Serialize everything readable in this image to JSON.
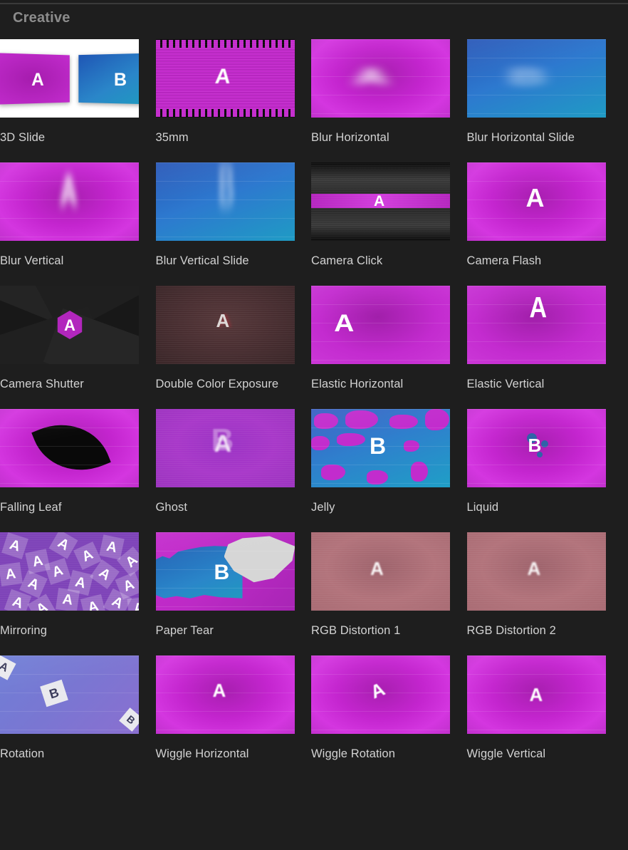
{
  "section": {
    "title": "Creative"
  },
  "items": [
    {
      "label": "3D Slide",
      "art": "slide3d",
      "letters": [
        "A",
        "B"
      ]
    },
    {
      "label": "35mm",
      "art": "film35",
      "letters": [
        "A"
      ]
    },
    {
      "label": "Blur Horizontal",
      "art": "blur-h",
      "letters": [
        "A"
      ]
    },
    {
      "label": "Blur Horizontal Slide",
      "art": "blur-h-slide",
      "letters": [
        "B"
      ]
    },
    {
      "label": "Blur Vertical",
      "art": "blur-v",
      "letters": [
        "A"
      ]
    },
    {
      "label": "Blur Vertical Slide",
      "art": "blur-v-slide",
      "letters": [
        "B"
      ]
    },
    {
      "label": "Camera Click",
      "art": "camera-click",
      "letters": [
        "A"
      ]
    },
    {
      "label": "Camera Flash",
      "art": "camera-flash",
      "letters": [
        "A"
      ]
    },
    {
      "label": "Camera Shutter",
      "art": "camera-shutter",
      "letters": [
        "A"
      ]
    },
    {
      "label": "Double Color Exposure",
      "art": "double-exposure",
      "letters": [
        "A"
      ]
    },
    {
      "label": "Elastic Horizontal",
      "art": "elastic-h",
      "letters": [
        "A"
      ]
    },
    {
      "label": "Elastic Vertical",
      "art": "elastic-v",
      "letters": [
        "A"
      ]
    },
    {
      "label": "Falling Leaf",
      "art": "falling-leaf",
      "letters": []
    },
    {
      "label": "Ghost",
      "art": "ghost",
      "letters": [
        "A",
        "B"
      ]
    },
    {
      "label": "Jelly",
      "art": "jelly",
      "letters": [
        "B"
      ]
    },
    {
      "label": "Liquid",
      "art": "liquid",
      "letters": [
        "B"
      ]
    },
    {
      "label": "Mirroring",
      "art": "mirroring",
      "letters": [
        "A"
      ]
    },
    {
      "label": "Paper Tear",
      "art": "paper-tear",
      "letters": [
        "B"
      ]
    },
    {
      "label": "RGB Distortion 1",
      "art": "rgb1",
      "letters": [
        "A"
      ]
    },
    {
      "label": "RGB Distortion 2",
      "art": "rgb2",
      "letters": [
        "A"
      ]
    },
    {
      "label": "Rotation",
      "art": "rotation",
      "letters": [
        "B"
      ]
    },
    {
      "label": "Wiggle Horizontal",
      "art": "wiggle-h",
      "letters": [
        "A"
      ]
    },
    {
      "label": "Wiggle Rotation",
      "art": "wiggle-r",
      "letters": [
        "A"
      ]
    },
    {
      "label": "Wiggle Vertical",
      "art": "wiggle-v",
      "letters": [
        "A"
      ]
    }
  ],
  "colors": {
    "background": "#1e1e1e",
    "divider": "#3a3a3a",
    "section_title": "#8c8c8c",
    "label": "#d2d2d2",
    "magenta": "#c42ccd",
    "blue": "#2a86c9",
    "white": "#ffffff"
  },
  "layout": {
    "columns": 4,
    "rows": 6,
    "thumb_width": 195,
    "thumb_height": 110
  }
}
